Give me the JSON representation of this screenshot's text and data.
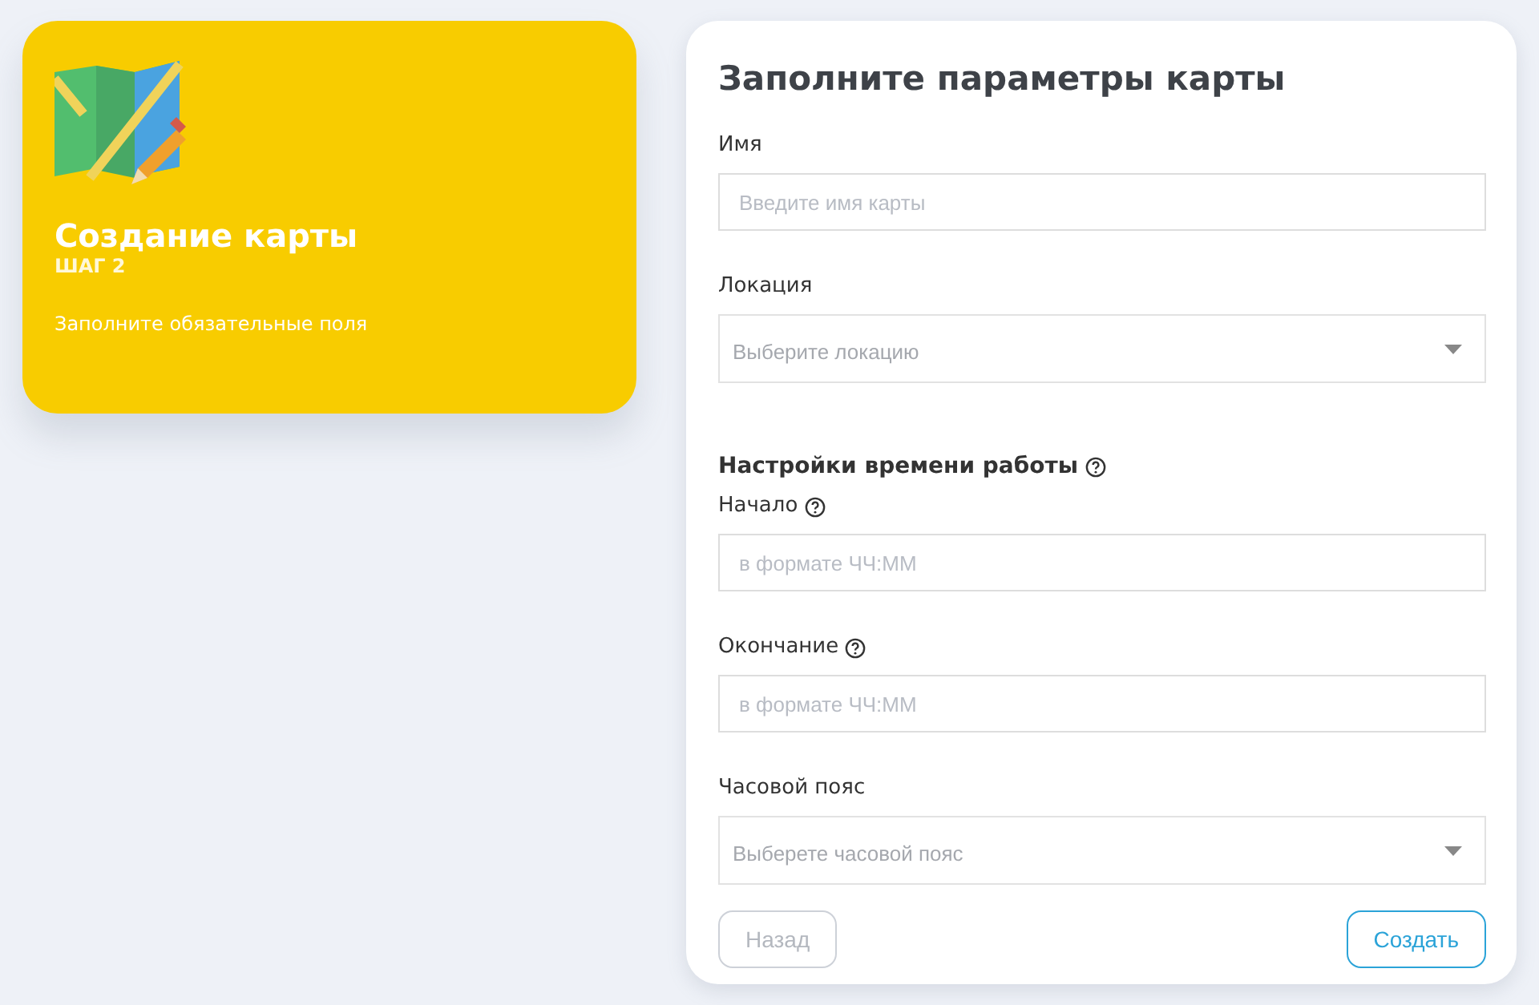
{
  "step_card": {
    "title": "Создание карты",
    "step": "ШАГ 2",
    "hint": "Заполните обязательные поля"
  },
  "form": {
    "title": "Заполните параметры карты",
    "fields": [
      {
        "kind": "input",
        "label": "Имя",
        "help": false,
        "placeholder": "Введите имя карты"
      },
      {
        "kind": "select",
        "label": "Локация",
        "help": false,
        "placeholder": "Выберите локацию"
      },
      {
        "kind": "heading",
        "label": "Настройки времени работы",
        "help": true
      },
      {
        "kind": "input",
        "label": "Начало",
        "help": true,
        "placeholder": "в формате ЧЧ:ММ"
      },
      {
        "kind": "input",
        "label": "Окончание",
        "help": true,
        "placeholder": "в формате ЧЧ:ММ"
      },
      {
        "kind": "select",
        "label": "Часовой пояс",
        "help": false,
        "placeholder": "Выберете часовой пояс"
      }
    ],
    "buttons": [
      {
        "label": "Назад",
        "disabled": true
      },
      {
        "label": "Создать",
        "disabled": false
      }
    ]
  }
}
